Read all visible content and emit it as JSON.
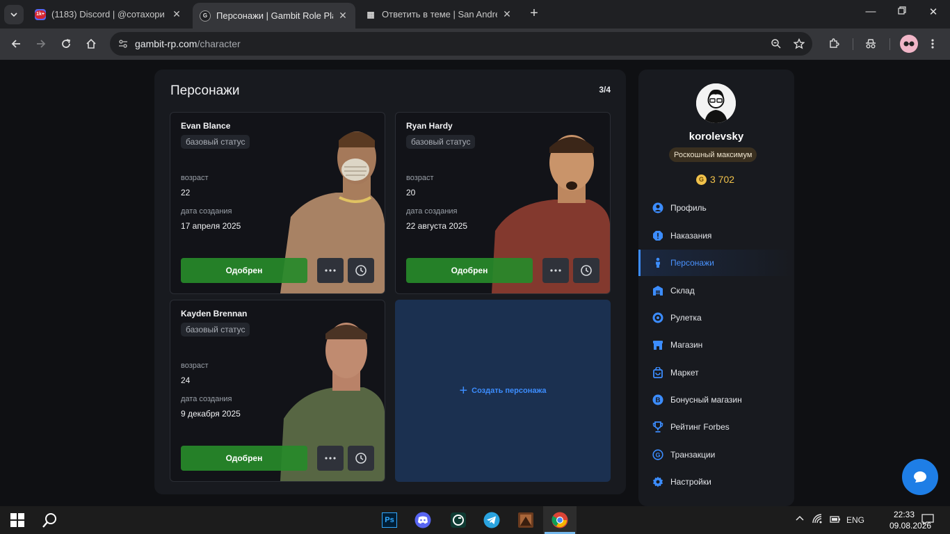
{
  "browser": {
    "tabs": [
      {
        "title": "(1183) Discord | @сотахори",
        "favicon": "discord-badge",
        "badge": "1k+",
        "active": false
      },
      {
        "title": "Персонажи | Gambit Role Play",
        "favicon": "gambit-logo",
        "active": true
      },
      {
        "title": "Ответить в теме | San Andreas",
        "favicon": "forum-icon",
        "active": false
      }
    ],
    "url_host": "gambit-rp.com",
    "url_path": "/character",
    "profile_icon": "glasses-avatar"
  },
  "main": {
    "title": "Персонажи",
    "counter": "3/4",
    "labels": {
      "status": "базовый статус",
      "age": "возраст",
      "created": "дата создания",
      "approved": "Одобрен"
    },
    "characters": [
      {
        "name": "Evan Blance",
        "age": "22",
        "created": "17 апреля 2025",
        "skin_color": "#b58a6a",
        "shirt_color": "#b58a6a"
      },
      {
        "name": "Ryan Hardy",
        "age": "20",
        "created": "22 августа 2025",
        "skin_color": "#c9946a",
        "shirt_color": "#8a3b2f"
      },
      {
        "name": "Kayden Brennan",
        "age": "24",
        "created": "9 декабря 2025",
        "skin_color": "#c08b70",
        "shirt_color": "#5c6a46"
      }
    ],
    "create_label": "Создать персонажа"
  },
  "sidebar": {
    "username": "korolevsky",
    "tier": "Роскошный максимум",
    "coins": "3 702",
    "items": [
      {
        "label": "Профиль",
        "icon": "user-icon",
        "active": false
      },
      {
        "label": "Наказания",
        "icon": "warning-icon",
        "active": false
      },
      {
        "label": "Персонажи",
        "icon": "person-icon",
        "active": true
      },
      {
        "label": "Склад",
        "icon": "warehouse-icon",
        "active": false
      },
      {
        "label": "Рулетка",
        "icon": "roulette-icon",
        "active": false
      },
      {
        "label": "Магазин",
        "icon": "shop-icon",
        "active": false
      },
      {
        "label": "Маркет",
        "icon": "bag-icon",
        "active": false
      },
      {
        "label": "Бонусный магазин",
        "icon": "bonus-icon",
        "active": false
      },
      {
        "label": "Рейтинг Forbes",
        "icon": "trophy-icon",
        "active": false
      },
      {
        "label": "Транзакции",
        "icon": "transactions-icon",
        "active": false
      },
      {
        "label": "Настройки",
        "icon": "gear-icon",
        "active": false
      }
    ]
  },
  "taskbar": {
    "lang": "ENG",
    "time": "22:33",
    "date": "09.08.2026",
    "apps": [
      "photoshop-icon",
      "discord-icon",
      "gta-launcher-icon",
      "telegram-icon",
      "game-icon",
      "chrome-icon"
    ],
    "photoshop_label": "Ps"
  },
  "colors": {
    "accent": "#3c8dff",
    "approve": "#278a2a",
    "coin": "#f1c24b"
  }
}
